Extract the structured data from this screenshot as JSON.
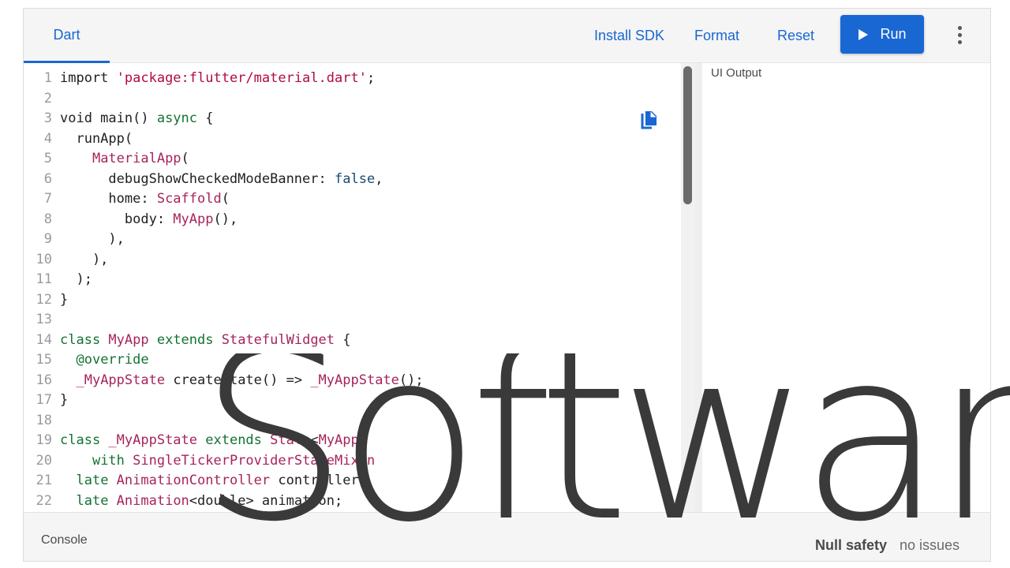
{
  "header": {
    "tab_label": "Dart",
    "install_sdk_label": "Install SDK",
    "format_label": "Format",
    "reset_label": "Reset",
    "run_label": "Run"
  },
  "editor": {
    "lines": [
      {
        "n": "1",
        "tokens": [
          [
            "plain",
            "import "
          ],
          [
            "str",
            "'package:flutter/material.dart'"
          ],
          [
            "plain",
            ";"
          ]
        ]
      },
      {
        "n": "2",
        "tokens": []
      },
      {
        "n": "3",
        "tokens": [
          [
            "plain",
            "void main() "
          ],
          [
            "kw",
            "async"
          ],
          [
            "plain",
            " {"
          ]
        ]
      },
      {
        "n": "4",
        "tokens": [
          [
            "plain",
            "  runApp("
          ]
        ]
      },
      {
        "n": "5",
        "tokens": [
          [
            "plain",
            "    "
          ],
          [
            "type",
            "MaterialApp"
          ],
          [
            "plain",
            "("
          ]
        ]
      },
      {
        "n": "6",
        "tokens": [
          [
            "plain",
            "      debugShowCheckedModeBanner: "
          ],
          [
            "num",
            "false"
          ],
          [
            "plain",
            ","
          ]
        ]
      },
      {
        "n": "7",
        "tokens": [
          [
            "plain",
            "      home: "
          ],
          [
            "type",
            "Scaffold"
          ],
          [
            "plain",
            "("
          ]
        ]
      },
      {
        "n": "8",
        "tokens": [
          [
            "plain",
            "        body: "
          ],
          [
            "type",
            "MyApp"
          ],
          [
            "plain",
            "(),"
          ]
        ]
      },
      {
        "n": "9",
        "tokens": [
          [
            "plain",
            "      ),"
          ]
        ]
      },
      {
        "n": "10",
        "tokens": [
          [
            "plain",
            "    ),"
          ]
        ]
      },
      {
        "n": "11",
        "tokens": [
          [
            "plain",
            "  );"
          ]
        ]
      },
      {
        "n": "12",
        "tokens": [
          [
            "plain",
            "}"
          ]
        ]
      },
      {
        "n": "13",
        "tokens": []
      },
      {
        "n": "14",
        "tokens": [
          [
            "kw",
            "class "
          ],
          [
            "type",
            "MyApp "
          ],
          [
            "kw",
            "extends "
          ],
          [
            "type",
            "StatefulWidget"
          ],
          [
            "plain",
            " {"
          ]
        ]
      },
      {
        "n": "15",
        "tokens": [
          [
            "plain",
            "  "
          ],
          [
            "meta",
            "@override"
          ]
        ]
      },
      {
        "n": "16",
        "tokens": [
          [
            "plain",
            "  "
          ],
          [
            "type",
            "_MyAppState"
          ],
          [
            "plain",
            " createState() => "
          ],
          [
            "type",
            "_MyAppState"
          ],
          [
            "plain",
            "();"
          ]
        ]
      },
      {
        "n": "17",
        "tokens": [
          [
            "plain",
            "}"
          ]
        ]
      },
      {
        "n": "18",
        "tokens": []
      },
      {
        "n": "19",
        "tokens": [
          [
            "kw",
            "class "
          ],
          [
            "type",
            "_MyAppState "
          ],
          [
            "kw",
            "extends "
          ],
          [
            "type",
            "State"
          ],
          [
            "plain",
            "<"
          ],
          [
            "type",
            "MyApp"
          ],
          [
            "plain",
            ">"
          ]
        ]
      },
      {
        "n": "20",
        "tokens": [
          [
            "plain",
            "    "
          ],
          [
            "kw",
            "with "
          ],
          [
            "type",
            "SingleTickerProviderStateMixin"
          ]
        ]
      },
      {
        "n": "21",
        "tokens": [
          [
            "plain",
            "  "
          ],
          [
            "kw",
            "late "
          ],
          [
            "type",
            "AnimationController"
          ],
          [
            "plain",
            " controller;"
          ]
        ]
      },
      {
        "n": "22",
        "tokens": [
          [
            "plain",
            "  "
          ],
          [
            "kw",
            "late "
          ],
          [
            "type",
            "Animation"
          ],
          [
            "plain",
            "<double> animation;"
          ]
        ]
      }
    ]
  },
  "output": {
    "title": "UI Output"
  },
  "footer": {
    "console_label": "Console",
    "null_safety_label": "Null safety",
    "issues_label": "no issues"
  },
  "watermark": {
    "text": "Software"
  },
  "colors": {
    "accent": "#1967d2",
    "string": "#b00b45",
    "type": "#a6245c",
    "keyword": "#137333"
  }
}
